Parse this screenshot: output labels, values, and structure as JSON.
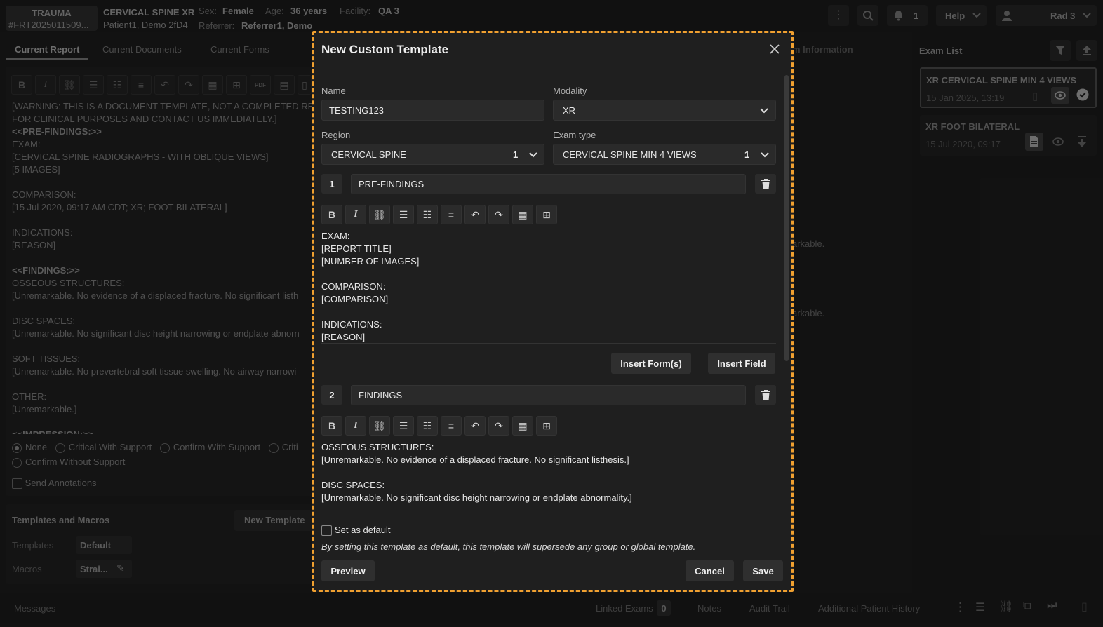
{
  "header": {
    "category": "TRAUMA",
    "accession": "#FRT2025011509...",
    "exam_title": "CERVICAL SPINE XR",
    "patient": "Patient1, Demo 2fD4",
    "sex_label": "Sex:",
    "sex": "Female",
    "age_label": "Age:",
    "age": "36 years",
    "facility_label": "Facility:",
    "facility": "QA 3",
    "referrer_label": "Referrer:",
    "referrer": "Referrer1, Demo",
    "notif_count": "1",
    "help": "Help",
    "user": "Rad 3"
  },
  "left": {
    "tabs": [
      "Current Report",
      "Current Documents",
      "Current Forms"
    ],
    "tab_behind": "m Information",
    "report_lines": [
      "[WARNING: THIS IS A DOCUMENT TEMPLATE, NOT A COMPLETED RE",
      "FOR CLINICAL PURPOSES AND CONTACT US IMMEDIATELY.]",
      "<<PRE-FINDINGS:>>",
      "EXAM:",
      "[CERVICAL SPINE RADIOGRAPHS - WITH OBLIQUE VIEWS]",
      "[5 IMAGES]",
      "",
      "COMPARISON:",
      "[15 Jul 2020, 09:17 AM CDT; XR; FOOT BILATERAL]",
      "",
      "INDICATIONS:",
      "[REASON]",
      "",
      "<<FINDINGS:>>",
      "OSSEOUS STRUCTURES:",
      "[Unremarkable. No evidence of a displaced fracture. No significant listh",
      "",
      "DISC SPACES:",
      "[Unremarkable. No significant disc height narrowing or endplate abnorn",
      "",
      "SOFT TISSUES:",
      "[Unremarkable. No prevertebral soft tissue swelling. No airway narrowi",
      "",
      "OTHER:",
      "[Unremarkable.]",
      "",
      "<<IMPRESSION:>>"
    ],
    "behind_text_1": "arkable.",
    "behind_text_2": "arkable.",
    "radios": [
      "None",
      "Critical With Support",
      "Confirm With Support",
      "Criti",
      "Confirm Without Support"
    ],
    "send_annotations": "Send Annotations",
    "templates_title": "Templates and Macros",
    "new_template": "New Template",
    "templates_label": "Templates",
    "templates_value": "Default",
    "macros_label": "Macros",
    "macros_value": "Strai..."
  },
  "right": {
    "title": "Exam List",
    "exams": [
      {
        "name": "XR CERVICAL SPINE MIN 4 VIEWS",
        "date": "15 Jan 2025, 13:19"
      },
      {
        "name": "XR FOOT BILATERAL",
        "date": "15 Jul 2020, 09:17"
      }
    ]
  },
  "modal": {
    "title": "New Custom Template",
    "name_label": "Name",
    "name_value": "TESTING123",
    "modality_label": "Modality",
    "modality_value": "XR",
    "region_label": "Region",
    "region_value": "CERVICAL SPINE",
    "region_count": "1",
    "exam_type_label": "Exam type",
    "exam_type_value": "CERVICAL SPINE MIN 4 VIEWS",
    "exam_type_count": "1",
    "sections": [
      {
        "num": "1",
        "title": "PRE-FINDINGS",
        "body": "EXAM:\n[REPORT TITLE]\n[NUMBER OF IMAGES]\n\nCOMPARISON:\n[COMPARISON]\n\nINDICATIONS:\n[REASON]"
      },
      {
        "num": "2",
        "title": "FINDINGS",
        "body": "OSSEOUS STRUCTURES:\n[Unremarkable. No evidence of a displaced fracture. No significant listhesis.]\n\nDISC SPACES:\n[Unremarkable. No significant disc height narrowing or endplate abnormality.]"
      }
    ],
    "insert_forms": "Insert Form(s)",
    "insert_field": "Insert Field",
    "set_default": "Set as default",
    "default_note": "By setting this template as default, this template will supersede any group or global template.",
    "preview": "Preview",
    "cancel": "Cancel",
    "save": "Save"
  },
  "bottom": {
    "messages": "Messages",
    "linked_exams": "Linked Exams",
    "linked_count": "0",
    "notes": "Notes",
    "audit_trail": "Audit Trail",
    "history": "Additional Patient History"
  },
  "colors": {
    "accent_dash": "#f0a030",
    "modal_bg": "#1f1f1f",
    "page_bg": "#1a1a1a"
  }
}
